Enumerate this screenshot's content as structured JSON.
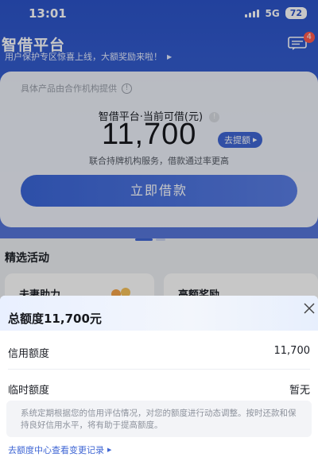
{
  "status_bar": {
    "time": "13:01",
    "network": "5G",
    "battery": "72"
  },
  "header": {
    "title": "智借平台",
    "notice": "用户保护专区惊喜上线，大额奖励来啦！",
    "message_badge": "4"
  },
  "card": {
    "note": "具体产品由合作机构提供",
    "subtitle": "智借平台·当前可借(元)",
    "amount": "11,700",
    "raise_button": "去提额",
    "description": "联合持牌机构服务，借款通过率更高",
    "borrow_button": "立即借款"
  },
  "activities": {
    "title": "精选活动",
    "items": [
      {
        "label": "夫妻助力"
      },
      {
        "label": "高额奖励"
      }
    ]
  },
  "sheet": {
    "title": "总额度11,700元",
    "rows": [
      {
        "label": "信用额度",
        "value": "11,700"
      },
      {
        "label": "临时额度",
        "value": "暂无"
      }
    ],
    "tip": "系统定期根据您的信用评估情况，对您的额度进行动态调整。按时还款和保持良好信用水平，将有助于提高额度。",
    "history_link": "去额度中心查看变更记录"
  },
  "colors": {
    "brand": "#3f66d4",
    "header": "#2c54c9",
    "badge": "#ff5a4e"
  }
}
